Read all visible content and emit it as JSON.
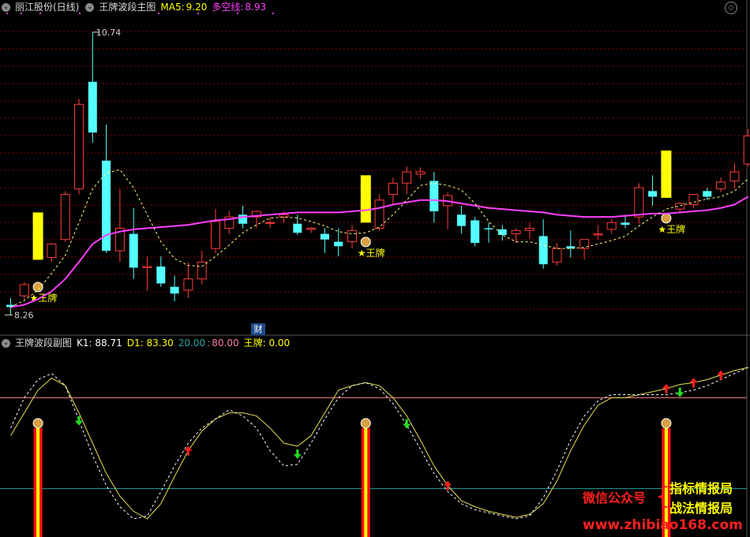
{
  "main": {
    "stock": "丽江股份(日线)",
    "indicator": "王牌波段主图",
    "ma5_label": "MA5:",
    "ma5_value": "9.20",
    "dk_label": "多空线:",
    "dk_value": "8.93",
    "high_label": "10.74",
    "low_label": "8.26",
    "signal_label": "★王牌",
    "cai_label": "财"
  },
  "sub": {
    "indicator": "王牌波段副图",
    "k1": "K1: 88.71",
    "d1": "D1: 83.30",
    "level_low": "20.00",
    "level_high": "80.00",
    "wp": "王牌: 0.00"
  },
  "watermark": {
    "wechat": "微信公众号",
    "line1": "指标情报局",
    "line2": "战法情报局",
    "site": "www.zhibiao168.com"
  },
  "colors": {
    "up": "#ff3c3c",
    "down": "#54ffff",
    "signal": "#ffff00",
    "ma_line": "#ff40ff",
    "dash": "#ffff80",
    "grid": "#8b0000"
  },
  "candles": [
    [
      8.32,
      8.38,
      8.23,
      8.3,
      0
    ],
    [
      8.4,
      8.52,
      8.37,
      8.5,
      0
    ],
    [
      8.52,
      8.75,
      8.5,
      8.72,
      1
    ],
    [
      8.74,
      8.87,
      8.7,
      8.86,
      0
    ],
    [
      8.9,
      9.33,
      8.88,
      9.3,
      0
    ],
    [
      9.35,
      10.15,
      9.3,
      10.1,
      0
    ],
    [
      10.3,
      10.74,
      9.76,
      9.85,
      0
    ],
    [
      9.6,
      9.92,
      8.78,
      8.8,
      0
    ],
    [
      8.8,
      9.35,
      8.7,
      9.0,
      0
    ],
    [
      8.95,
      9.18,
      8.55,
      8.65,
      0
    ],
    [
      8.65,
      8.75,
      8.45,
      8.66,
      0
    ],
    [
      8.66,
      8.75,
      8.48,
      8.51,
      0
    ],
    [
      8.48,
      8.58,
      8.35,
      8.42,
      0
    ],
    [
      8.45,
      8.7,
      8.38,
      8.55,
      0
    ],
    [
      8.55,
      8.8,
      8.5,
      8.7,
      0
    ],
    [
      8.82,
      9.17,
      8.78,
      9.06,
      0
    ],
    [
      9.0,
      9.15,
      8.95,
      9.1,
      0
    ],
    [
      9.12,
      9.2,
      9.0,
      9.04,
      0
    ],
    [
      9.1,
      9.16,
      9.0,
      9.15,
      0
    ],
    [
      9.05,
      9.1,
      9.0,
      9.05,
      0
    ],
    [
      9.1,
      9.15,
      9.05,
      9.12,
      0
    ],
    [
      9.04,
      9.12,
      8.94,
      8.96,
      0
    ],
    [
      8.99,
      9.01,
      8.96,
      9.0,
      0
    ],
    [
      8.95,
      9.0,
      8.78,
      8.9,
      0
    ],
    [
      8.88,
      9.0,
      8.75,
      8.84,
      0
    ],
    [
      8.88,
      9.03,
      8.82,
      8.98,
      0
    ],
    [
      8.92,
      9.1,
      8.88,
      9.05,
      1
    ],
    [
      9.0,
      9.3,
      8.98,
      9.25,
      0
    ],
    [
      9.3,
      9.45,
      9.2,
      9.4,
      0
    ],
    [
      9.4,
      9.55,
      9.3,
      9.5,
      0
    ],
    [
      9.48,
      9.54,
      9.44,
      9.5,
      0
    ],
    [
      9.42,
      9.5,
      9.05,
      9.15,
      0
    ],
    [
      9.2,
      9.32,
      8.99,
      9.29,
      0
    ],
    [
      9.12,
      9.2,
      8.95,
      9.02,
      0
    ],
    [
      9.07,
      9.1,
      8.84,
      8.87,
      0
    ],
    [
      9.0,
      9.05,
      8.87,
      8.99,
      0
    ],
    [
      8.99,
      9.03,
      8.89,
      8.94,
      0
    ],
    [
      8.95,
      9.0,
      8.87,
      8.98,
      0
    ],
    [
      8.98,
      9.05,
      8.91,
      9.0,
      0
    ],
    [
      8.93,
      9.08,
      8.64,
      8.68,
      0
    ],
    [
      8.7,
      8.87,
      8.67,
      8.82,
      0
    ],
    [
      8.84,
      8.98,
      8.74,
      8.82,
      0
    ],
    [
      8.82,
      8.9,
      8.72,
      8.9,
      0
    ],
    [
      8.94,
      9.03,
      8.9,
      8.95,
      0
    ],
    [
      8.99,
      9.08,
      8.95,
      9.05,
      0
    ],
    [
      9.05,
      9.12,
      9.0,
      9.03,
      0
    ],
    [
      9.1,
      9.4,
      9.04,
      9.36,
      0
    ],
    [
      9.33,
      9.47,
      9.2,
      9.28,
      0
    ],
    [
      9.13,
      9.28,
      9.05,
      9.27,
      1
    ],
    [
      9.17,
      9.23,
      9.13,
      9.22,
      0
    ],
    [
      9.21,
      9.3,
      9.18,
      9.3,
      0
    ],
    [
      9.33,
      9.36,
      9.25,
      9.28,
      0
    ],
    [
      9.35,
      9.45,
      9.32,
      9.41,
      0
    ],
    [
      9.42,
      9.58,
      9.35,
      9.5,
      0
    ],
    [
      9.57,
      9.88,
      9.55,
      9.82,
      0
    ]
  ],
  "ma_line": [
    8.3,
    8.32,
    8.37,
    8.44,
    8.55,
    8.7,
    8.86,
    8.94,
    8.97,
    8.99,
    9.0,
    9.01,
    9.02,
    9.03,
    9.05,
    9.07,
    9.08,
    9.1,
    9.11,
    9.12,
    9.13,
    9.14,
    9.14,
    9.14,
    9.14,
    9.15,
    9.16,
    9.18,
    9.21,
    9.23,
    9.25,
    9.25,
    9.24,
    9.22,
    9.2,
    9.18,
    9.17,
    9.16,
    9.15,
    9.14,
    9.12,
    9.11,
    9.1,
    9.1,
    9.1,
    9.11,
    9.12,
    9.13,
    9.13,
    9.14,
    9.15,
    9.16,
    9.18,
    9.21,
    9.28
  ],
  "ma5_line": [
    8.3,
    8.36,
    8.45,
    8.6,
    8.76,
    9.05,
    9.35,
    9.49,
    9.52,
    9.36,
    9.12,
    8.88,
    8.73,
    8.67,
    8.66,
    8.75,
    8.85,
    8.96,
    9.03,
    9.09,
    9.1,
    9.09,
    9.06,
    9.02,
    8.97,
    8.95,
    8.96,
    9.01,
    9.12,
    9.25,
    9.38,
    9.4,
    9.38,
    9.34,
    9.22,
    9.06,
    8.94,
    8.88,
    8.88,
    8.85,
    8.82,
    8.82,
    8.83,
    8.86,
    8.89,
    8.93,
    9.02,
    9.1,
    9.17,
    9.2,
    9.23,
    9.26,
    9.28,
    9.33,
    9.44
  ],
  "k1_line": [
    55,
    70,
    85,
    93,
    88,
    70,
    50,
    30,
    15,
    5,
    0,
    10,
    28,
    45,
    58,
    66,
    70,
    70,
    68,
    60,
    50,
    48,
    55,
    70,
    85,
    88,
    90,
    88,
    80,
    68,
    52,
    35,
    22,
    12,
    8,
    5,
    3,
    1,
    3,
    10,
    25,
    45,
    62,
    75,
    80,
    80,
    82,
    84,
    86,
    88.71,
    90,
    92,
    95,
    98,
    100
  ],
  "d1_line": [
    60,
    80,
    92,
    96,
    88,
    65,
    42,
    22,
    8,
    0,
    2,
    18,
    35,
    50,
    60,
    66,
    72,
    68,
    60,
    45,
    35,
    36,
    50,
    66,
    80,
    88,
    90,
    86,
    76,
    62,
    46,
    30,
    18,
    10,
    6,
    4,
    2,
    0,
    2,
    14,
    32,
    52,
    68,
    78,
    82,
    82,
    82,
    82,
    82,
    83.3,
    85,
    88,
    92,
    96,
    100
  ],
  "up_arrows": [
    13,
    32,
    48,
    50,
    52,
    57
  ],
  "down_arrows": [
    5,
    21,
    29,
    49,
    60
  ]
}
